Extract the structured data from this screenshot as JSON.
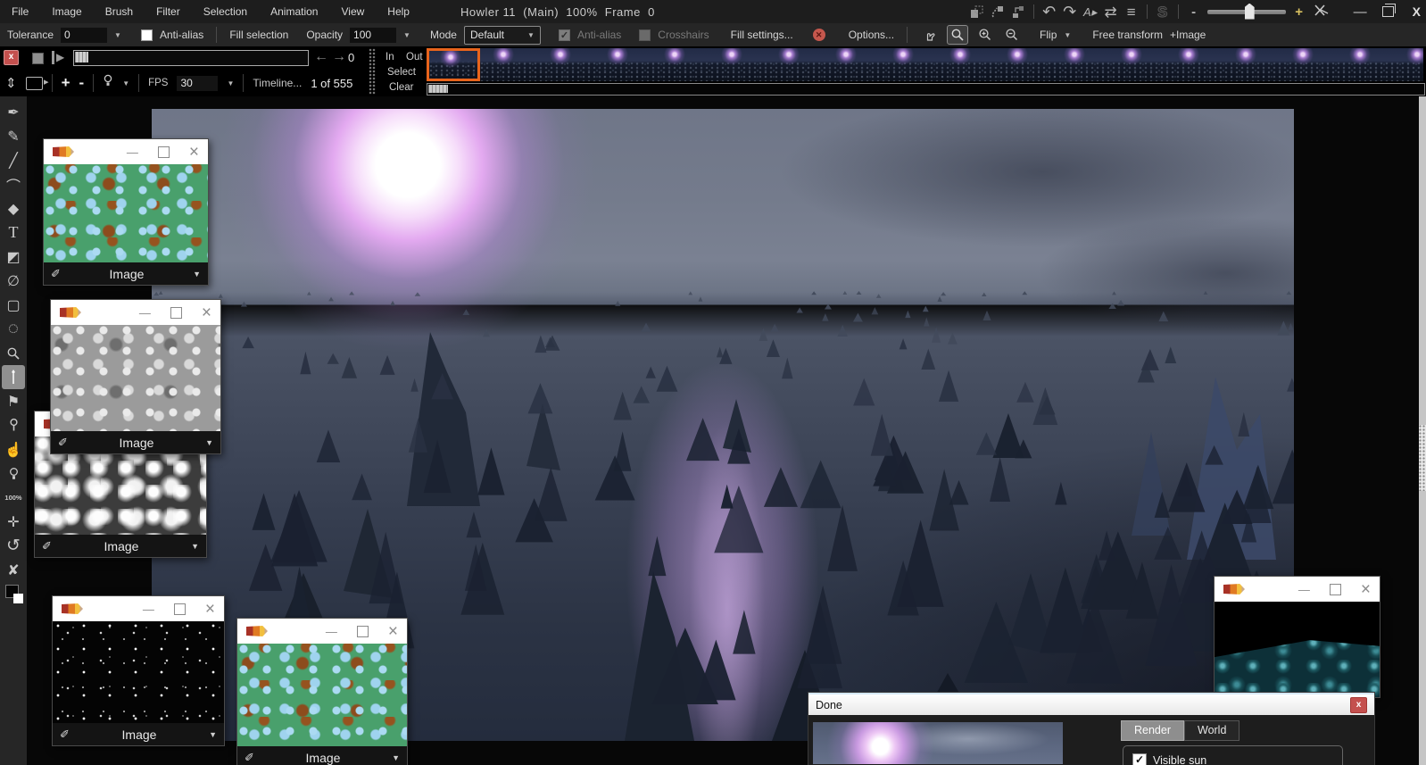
{
  "app": {
    "menu_items": [
      "File",
      "Image",
      "Brush",
      "Filter",
      "Selection",
      "Animation",
      "View",
      "Help"
    ],
    "title": "Howler 11  (Main)  100%  Frame  0"
  },
  "titlebar": {
    "icons": {
      "undo": "↶",
      "redo": "↷",
      "text_arrow": "A▸",
      "mirror": "⇄",
      "layers": "≡",
      "s_tool": "S",
      "slider_minus": "-",
      "slider_plus": "+"
    },
    "minimize_label": "—",
    "close_label": "X"
  },
  "options_bar": {
    "tolerance_label": "Tolerance",
    "tolerance_value": "0",
    "antialias_label": "Anti-alias",
    "fill_selection_label": "Fill selection",
    "opacity_label": "Opacity",
    "opacity_value": "100",
    "mode_label": "Mode",
    "mode_value": "Default",
    "antialias_disabled_label": "Anti-alias",
    "antialias_disabled_checked": true,
    "crosshairs_label": "Crosshairs",
    "fill_settings_label": "Fill settings...",
    "options_label": "Options...",
    "flip_label": "Flip",
    "free_transform_label": "Free transform",
    "add_image_label": "+Image"
  },
  "timeline": {
    "frame_value": "0",
    "fps_label": "FPS",
    "fps_value": "30",
    "timeline_button_label": "Timeline...",
    "frame_counter": "1 of 555",
    "in_label": "In",
    "out_label": "Out",
    "select_label": "Select",
    "clear_label": "Clear"
  },
  "tools": [
    {
      "name": "pen",
      "glyph": "✒"
    },
    {
      "name": "smear-brush",
      "glyph": "✎"
    },
    {
      "name": "polyline",
      "glyph": "╱"
    },
    {
      "name": "curve",
      "glyph": "⌒"
    },
    {
      "name": "filled-shape",
      "glyph": "◆"
    },
    {
      "name": "text",
      "glyph": "T"
    },
    {
      "name": "gradient",
      "glyph": "◩"
    },
    {
      "name": "no-selection",
      "glyph": "∅"
    },
    {
      "name": "rect-select",
      "glyph": "▢"
    },
    {
      "name": "ellipse-select",
      "glyph": "◌"
    },
    {
      "name": "zoom-magnifier"
    },
    {
      "name": "magic-wand",
      "selected": true
    },
    {
      "name": "lasso-flag",
      "glyph": "⚑"
    },
    {
      "name": "picker"
    },
    {
      "name": "finger",
      "glyph": "☝"
    },
    {
      "name": "browse-light"
    },
    {
      "name": "zoom-100",
      "glyph": "100%"
    },
    {
      "name": "pan",
      "glyph": "✛"
    },
    {
      "name": "rotate",
      "glyph": "↺"
    },
    {
      "name": "unpin",
      "glyph": "✘"
    }
  ],
  "palettes": {
    "footer_label": "Image"
  },
  "done_dialog": {
    "title": "Done",
    "close_label": "x",
    "tabs": [
      {
        "label": "Render",
        "active": true
      },
      {
        "label": "World",
        "active": false
      }
    ],
    "visible_sun_label": "Visible sun",
    "visible_sun_checked": true
  },
  "colors": {
    "selection_border": "#e8641c",
    "close_red": "#c4504e",
    "sun_glow": "#e3a9f0",
    "texture_teal": "#49a06c",
    "texture_brown": "#8d4c1d",
    "texture_blue": "#abdaf2"
  }
}
